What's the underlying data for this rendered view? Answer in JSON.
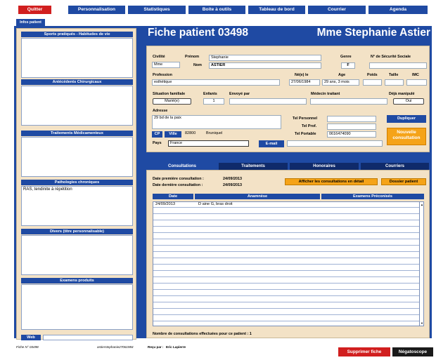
{
  "menu": {
    "quit": "Quitter",
    "personalisation": "Personnalisation",
    "stats": "Statistiques",
    "tools": "Boite à outils",
    "dashboard": "Tableau de bord",
    "mail": "Courrier",
    "agenda": "Agenda"
  },
  "left": {
    "tab": "Infos patient",
    "sports": "Sports pratiqués - Habitudes de vie",
    "sports_value": "",
    "antecedents": "Antécédents Chirurgicaux",
    "antecedents_value": "",
    "treatments": "Traitements Médicamenteux",
    "treatments_value": "",
    "pathologies": "Pathologies chroniques",
    "pathologies_value": "RAS, tendinite à répétition",
    "divers": "Divers (titre personnalisable)",
    "divers_value": "",
    "exams": "Examens produits",
    "exams_value": "",
    "web": "Web",
    "web_value": ""
  },
  "header": {
    "title": "Fiche patient  03498",
    "patient_name": "Mme Stephanie Astier"
  },
  "info": {
    "civilite_label": "Civilité",
    "civilite": "Mme",
    "prenom_label": "Prénom",
    "prenom": "Stephanie",
    "nom_label": "Nom",
    "nom": "ASTIER",
    "genre_label": "Genre",
    "genre": "F",
    "secu_label": "N° de Sécurité Sociale",
    "secu": "",
    "profession_label": "Profession",
    "profession": "esthétique",
    "naissance_label": "Né(e) le",
    "naissance": "27/06/1984",
    "age_label": "Age",
    "age": "29 ans, 3 mois",
    "poids_label": "Poids",
    "poids": "",
    "taille_label": "Taille",
    "taille": "",
    "imc_label": "IMC",
    "imc": "",
    "situation_label": "Situation familiale",
    "situation": "Marié(e)",
    "enfants_label": "Enfants",
    "enfants": "1",
    "envoye_label": "Envoyé par",
    "envoye": "",
    "medecin_label": "Médecin traitant",
    "medecin": "",
    "manipule_label": "Déjà manipulé",
    "manipule": "Oui",
    "adresse_label": "Adresse",
    "adresse": "29 bd de la paix",
    "tel_perso_label": "Tel Personnel",
    "tel_perso": "",
    "tel_prof_label": "Tel Prof.",
    "tel_prof": "",
    "tel_portable_label": "Tel Portable",
    "tel_portable": "0616474090",
    "cp_label": "CP",
    "ville_label": "Ville",
    "cp": "82800",
    "ville": "Bruniquel",
    "pays_label": "Pays",
    "pays": "France",
    "email_label": "E-mail",
    "email": "",
    "duplicate": "Dupliquer",
    "new_consult": "Nouvelle consultation"
  },
  "tabs": {
    "consultations": "Consultations",
    "traitements": "Traitements",
    "honoraires": "Honoraires",
    "courriers": "Courriers"
  },
  "consult": {
    "first_label": "Date première consultation :",
    "first": "24/09/2013",
    "last_label": "Date dernière consultation :",
    "last": "24/09/2013",
    "detail_btn": "Afficher les consultations en détail",
    "dossier_btn": "Dossier patient",
    "col_date": "Date",
    "col_anamnese": "Anamnèse",
    "col_examens": "Examens Préconisés",
    "rows": [
      {
        "date": "24/09/2013",
        "anamnese": "D aine G, bras droit",
        "examens": ""
      }
    ],
    "count_label": "Nombre de consultations effectuées pour ce patient : 1"
  },
  "footer": {
    "fiche": "Fiche N° 03498",
    "user": "astierstephanie27061984",
    "recu_label": "Reçu par :",
    "recu": "Eric Lapierre",
    "delete": "Supprimer fiche",
    "negatoscope": "Négatoscope"
  }
}
